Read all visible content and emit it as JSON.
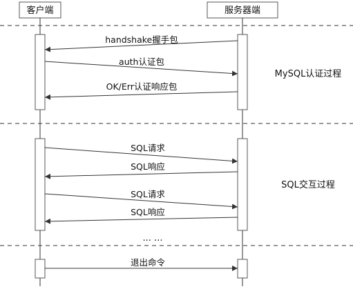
{
  "participants": {
    "client": "客户端",
    "server": "服务器端"
  },
  "phases": {
    "auth": "MySQL认证过程",
    "sql": "SQL交互过程"
  },
  "messages": {
    "handshake": "handshake握手包",
    "auth": "auth认证包",
    "auth_response": "OK/Err认证响应包",
    "sql_request_1": "SQL请求",
    "sql_response_1": "SQL响应",
    "sql_request_2": "SQL请求",
    "sql_response_2": "SQL响应",
    "quit": "退出命令"
  },
  "ellipsis": "... ...",
  "colors": {
    "line": "#333333",
    "box_border": "#555555",
    "activation_fill": "#ffffff"
  }
}
